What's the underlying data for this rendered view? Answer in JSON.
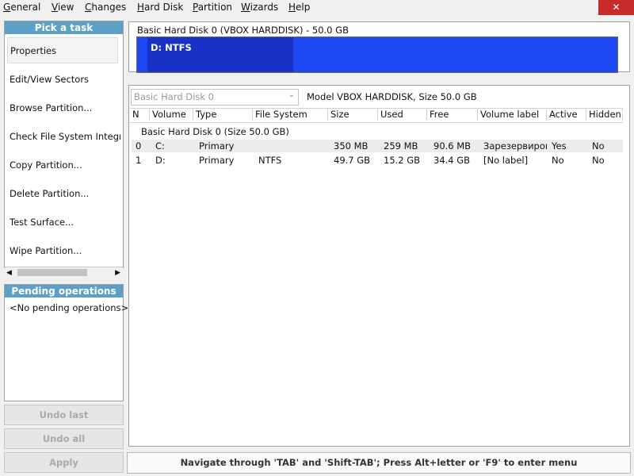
{
  "menu": {
    "items": [
      {
        "label": "General",
        "underline": "G"
      },
      {
        "label": "View",
        "underline": "V"
      },
      {
        "label": "Changes",
        "underline": "C"
      },
      {
        "label": "Hard Disk",
        "underline": "H"
      },
      {
        "label": "Partition",
        "underline": "P"
      },
      {
        "label": "Wizards",
        "underline": "W"
      },
      {
        "label": "Help",
        "underline": "H"
      }
    ],
    "close_glyph": "✕"
  },
  "tasks": {
    "header": "Pick a task",
    "items": [
      "Properties",
      "Edit/View Sectors",
      "Browse Partition...",
      "Check File System Integri",
      "Copy Partition...",
      "Delete Partition...",
      "Test Surface...",
      "Wipe Partition..."
    ],
    "scroll_left": "◀",
    "scroll_right": "▶"
  },
  "pending": {
    "header": "Pending operations",
    "empty_text": "<No pending operations>"
  },
  "buttons": {
    "undo_last": "Undo last",
    "undo_all": "Undo all",
    "apply": "Apply"
  },
  "disk_map": {
    "title": "Basic Hard Disk 0 (VBOX HARDDISK) - 50.0 GB",
    "partition_label": "D: NTFS",
    "partition_used_fraction": 0.31,
    "colors": {
      "reserved": "#e08a2a",
      "used": "#1a31c8",
      "free": "#1d47f2"
    }
  },
  "disk_selector": {
    "value": "Basic Hard Disk 0",
    "model_text": "Model VBOX HARDDISK, Size 50.0 GB"
  },
  "table": {
    "columns": [
      "N",
      "Volume",
      "Type",
      "File System",
      "Size",
      "Used",
      "Free",
      "Volume label",
      "Active",
      "Hidden"
    ],
    "group_label": "Basic Hard Disk 0 (Size 50.0 GB)",
    "rows": [
      {
        "n": "0",
        "volume": "C:",
        "type": "Primary",
        "fs": "",
        "size": "350 MB",
        "used": "259 MB",
        "free": "90.6 MB",
        "label": "Зарезервиров",
        "active": "Yes",
        "hidden": "No"
      },
      {
        "n": "1",
        "volume": "D:",
        "type": "Primary",
        "fs": "NTFS",
        "size": "49.7 GB",
        "used": "15.2 GB",
        "free": "34.4 GB",
        "label": "[No label]",
        "active": "No",
        "hidden": "No"
      }
    ]
  },
  "status": {
    "text": "Navigate through 'TAB' and 'Shift-TAB'; Press Alt+letter or 'F9' to enter menu"
  }
}
